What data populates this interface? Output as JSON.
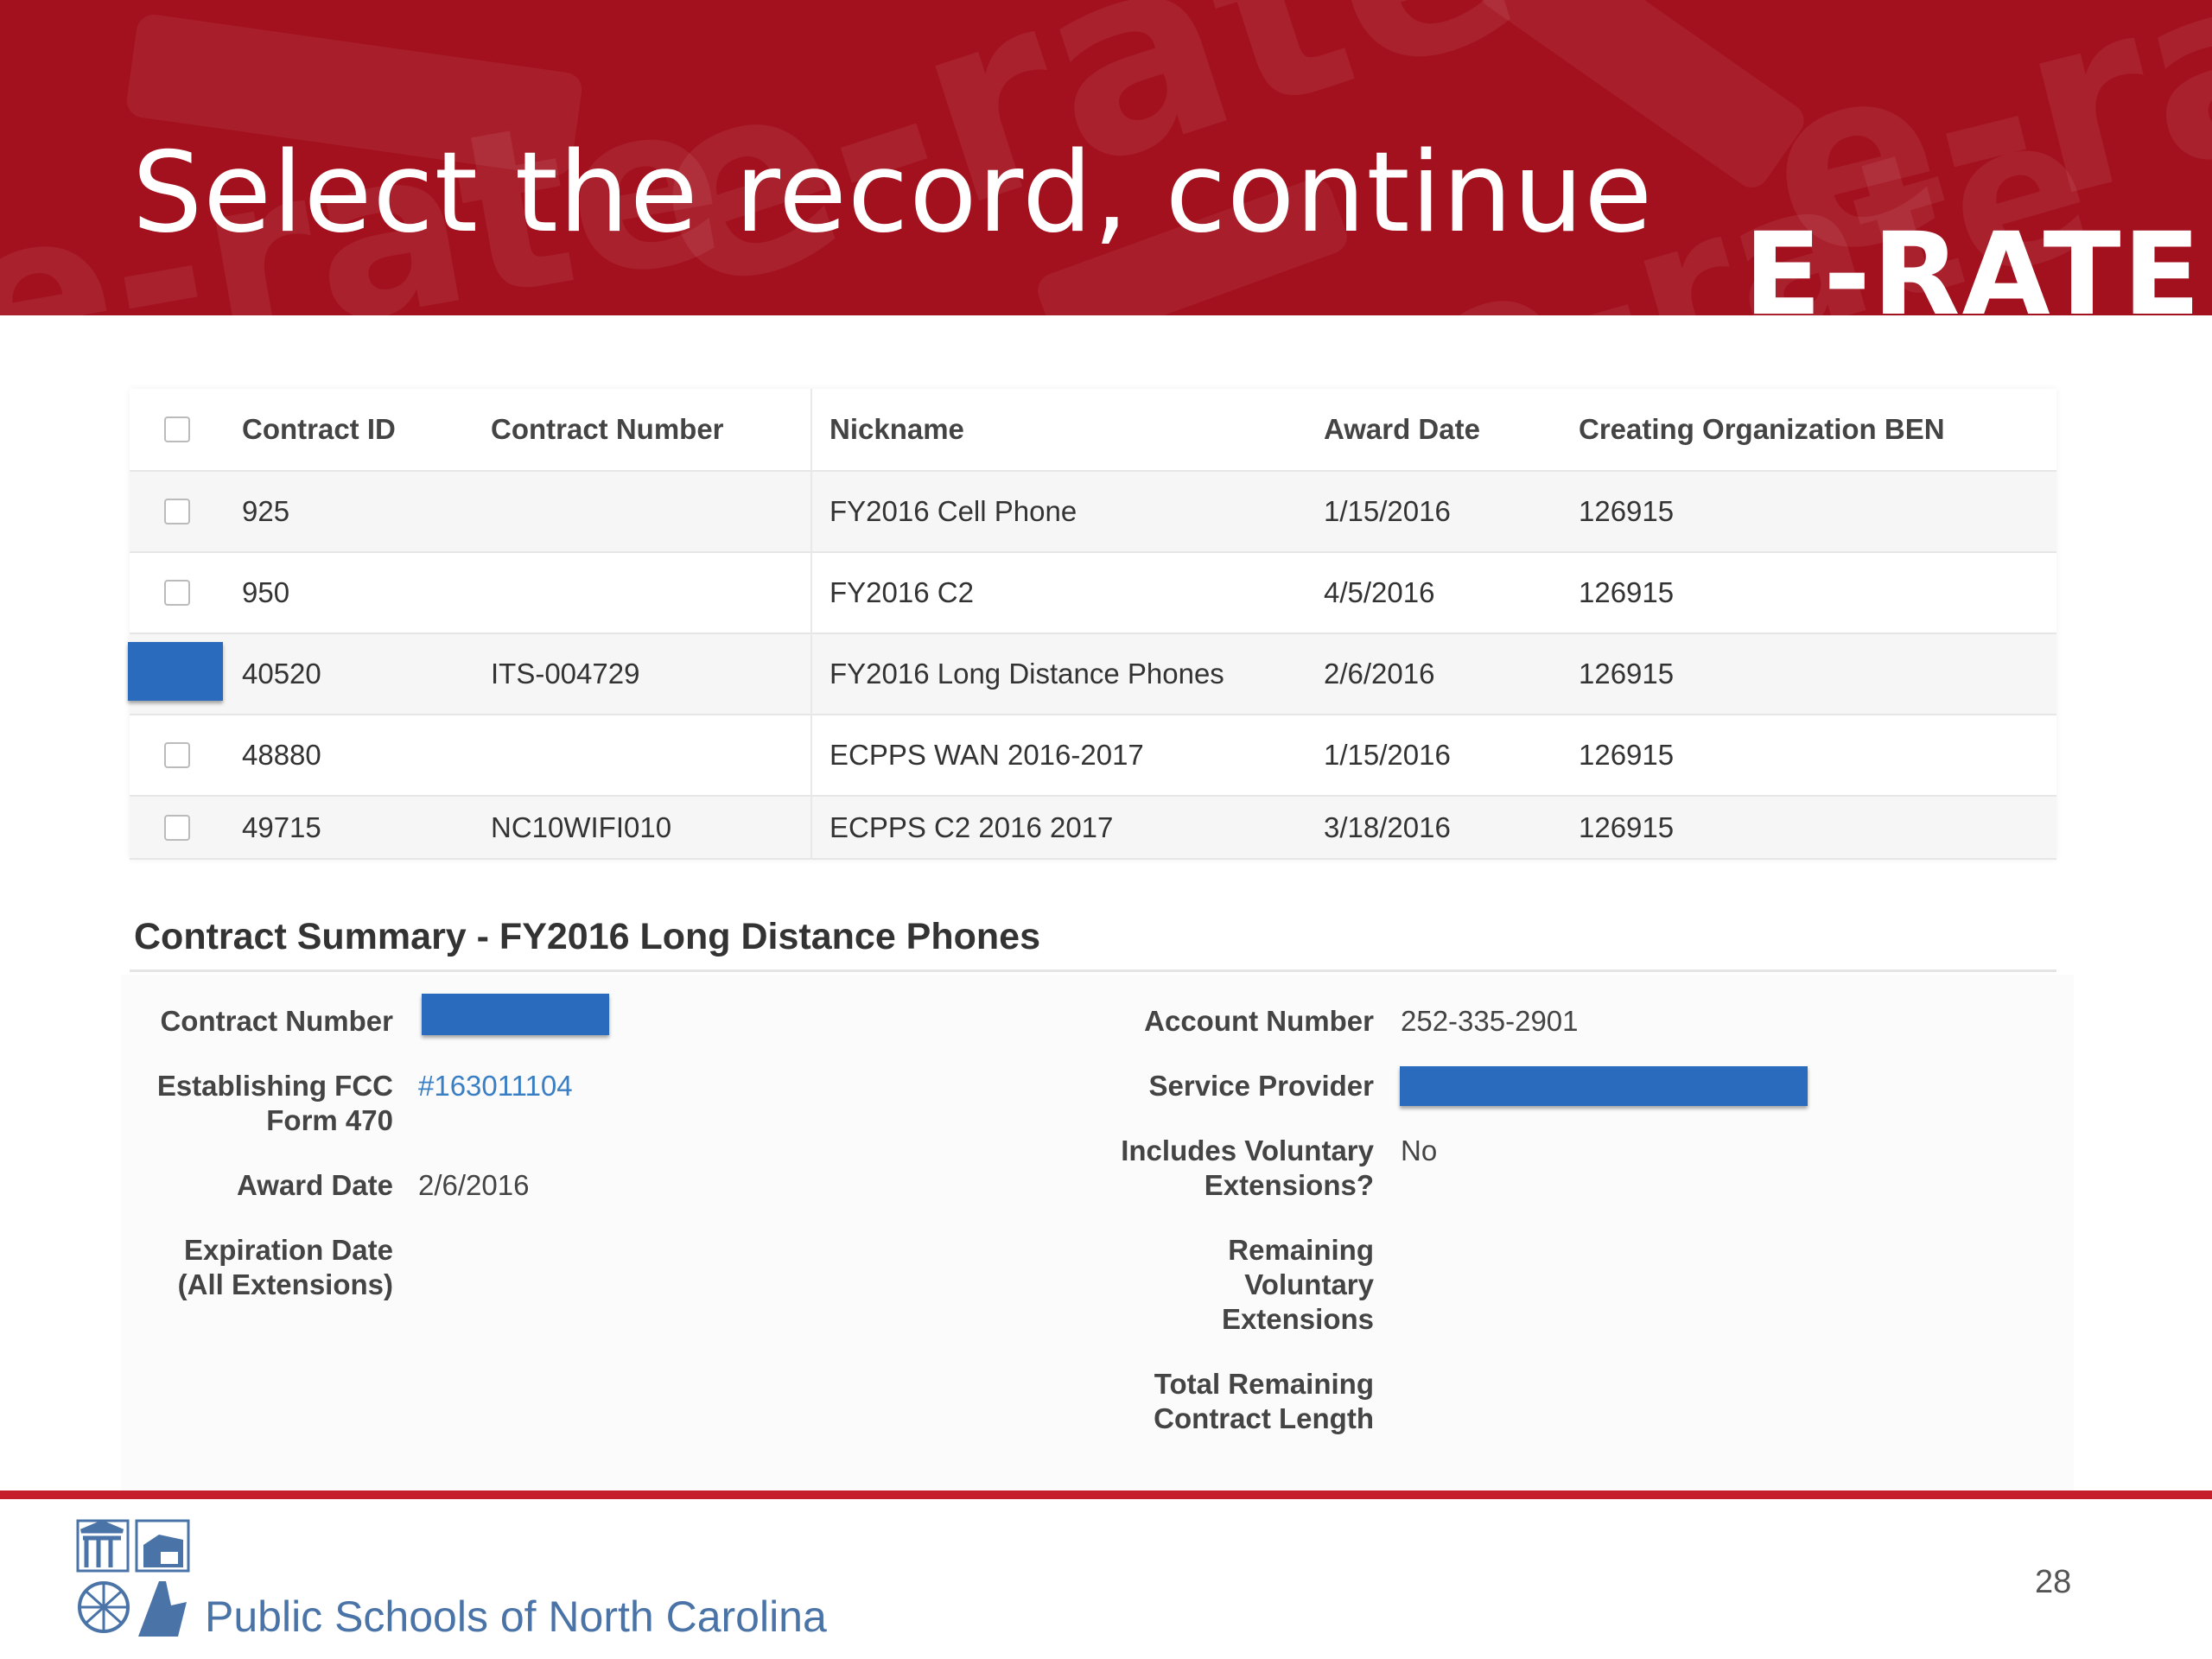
{
  "slide": {
    "title": "Select the record, continue",
    "logo_text": "E-RATE",
    "banner_watermark": "e-rate",
    "page_number": "28",
    "footer_org": "Public Schools of North Carolina"
  },
  "table": {
    "headers": {
      "contract_id": "Contract ID",
      "contract_number": "Contract Number",
      "nickname": "Nickname",
      "award_date": "Award Date",
      "ben": "Creating Organization BEN"
    },
    "rows": [
      {
        "id": "925",
        "number": "",
        "nickname": "FY2016 Cell Phone",
        "date": "1/15/2016",
        "ben": "126915"
      },
      {
        "id": "950",
        "number": "",
        "nickname": "FY2016 C2",
        "date": "4/5/2016",
        "ben": "126915"
      },
      {
        "id": "40520",
        "number": "ITS-004729",
        "nickname": "FY2016 Long Distance Phones",
        "date": "2/6/2016",
        "ben": "126915"
      },
      {
        "id": "48880",
        "number": "",
        "nickname": "ECPPS WAN 2016-2017",
        "date": "1/15/2016",
        "ben": "126915"
      },
      {
        "id": "49715",
        "number": "NC10WIFI010",
        "nickname": "ECPPS C2 2016 2017",
        "date": "3/18/2016",
        "ben": "126915"
      }
    ]
  },
  "summary": {
    "title": "Contract Summary - FY2016 Long Distance Phones",
    "labels": {
      "contract_number": "Contract Number",
      "establishing_fcc_line1": "Establishing FCC",
      "establishing_fcc_line2": "Form 470",
      "award_date": "Award Date",
      "expiration_line1": "Expiration Date",
      "expiration_line2": "(All Extensions)",
      "account_number": "Account Number",
      "service_provider": "Service Provider",
      "voluntary_line1": "Includes Voluntary",
      "voluntary_line2": "Extensions?",
      "remaining_line1": "Remaining",
      "remaining_line2": "Voluntary",
      "remaining_line3": "Extensions",
      "total_line1": "Total Remaining",
      "total_line2": "Contract Length"
    },
    "values": {
      "establishing_fcc": "#163011104",
      "award_date": "2/6/2016",
      "account_number": "252-335-2901",
      "voluntary": "No"
    }
  },
  "colors": {
    "banner": "#a3111e",
    "footer_rule": "#c41f2b",
    "redaction": "#2a6bbd",
    "link": "#3a7fc4",
    "footer_text": "#4a74a8"
  }
}
